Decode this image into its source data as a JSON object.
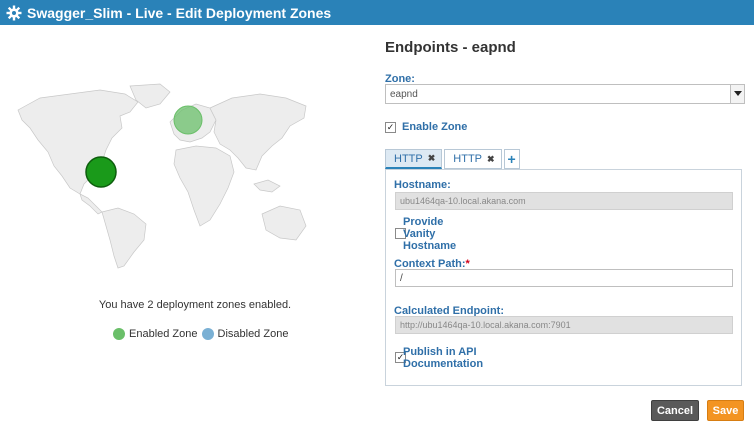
{
  "window": {
    "title": "Swagger_Slim - Live - Edit Deployment Zones"
  },
  "map": {
    "zones_message": "You have 2 deployment zones enabled.",
    "legend": [
      {
        "label": "Enabled Zone",
        "color": "#6abf69"
      },
      {
        "label": "Disabled Zone",
        "color": "#7ab0d4"
      }
    ]
  },
  "endpoints": {
    "title": "Endpoints - eapnd",
    "zone_label": "Zone:",
    "zone_value": "eapnd",
    "enable_zone_label": "Enable Zone",
    "enable_zone_checked": true,
    "tabs": [
      {
        "label": "HTTP",
        "active": true
      },
      {
        "label": "HTTP",
        "active": false
      }
    ],
    "hostname_label": "Hostname:",
    "hostname_value": "ubu1464qa-10.local.akana.com",
    "vanity_label": "Provide Vanity Hostname",
    "vanity_checked": false,
    "context_path_label": "Context Path:",
    "context_path_required": "*",
    "context_path_value": "/",
    "calculated_label": "Calculated Endpoint:",
    "calculated_value": "http://ubu1464qa-10.local.akana.com:7901",
    "publish_label": "Publish in API Documentation",
    "publish_checked": true
  },
  "buttons": {
    "cancel": "Cancel",
    "save": "Save"
  },
  "colors": {
    "titlebar": "#2a82b8",
    "label_blue": "#2f6fa8",
    "save": "#f39422",
    "cancel": "#5a5a5a",
    "zone_dark_green": "#1a9a1a",
    "zone_light_green": "#6abf69"
  }
}
